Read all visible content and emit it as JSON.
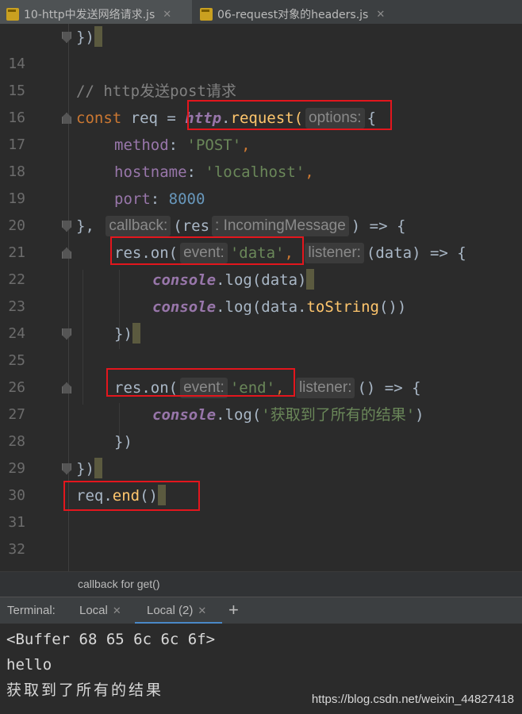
{
  "tabs": [
    {
      "label": "10-http中发送网络请求.js",
      "active": true
    },
    {
      "label": "06-request对象的headers.js",
      "active": false
    }
  ],
  "editor": {
    "line_numbers": [
      "14",
      "15",
      "16",
      "17",
      "18",
      "19",
      "20",
      "21",
      "22",
      "23",
      "24",
      "25",
      "26",
      "27",
      "28",
      "29",
      "30",
      "31",
      "32"
    ],
    "code": {
      "l14_close": "})",
      "l16_comment": "// http发送post请求",
      "l17_const": "const ",
      "l17_req": "req = ",
      "l17_http": "http",
      "l17_dot": ".",
      "l17_request": "request(",
      "l17_hint": "options:",
      "l17_brace": "{",
      "l18_key": "method",
      "l18_colon": ": ",
      "l18_val": "'POST'",
      "l18_comma": ",",
      "l19_key": "hostname",
      "l19_colon": ": ",
      "l19_val": "'localhost'",
      "l19_comma": ",",
      "l20_key": "port",
      "l20_colon": ": ",
      "l20_val": "8000",
      "l21_close": "},",
      "l21_hint": "callback:",
      "l21_paren": "(res",
      "l21_type": ": IncomingMessage",
      "l21_arrow": ") => {",
      "l22_res": "res.on(",
      "l22_hint": "event:",
      "l22_val": "'data'",
      "l22_comma": ",",
      "l22_hint2": "listener:",
      "l22_rest": "(data) => {",
      "l23_console": "console",
      "l23_rest": ".log(data)",
      "l24_console": "console",
      "l24_a": ".log(data.",
      "l24_fn": "toString",
      "l24_b": "())",
      "l25_close": "})",
      "l27_res": "res.on(",
      "l27_hint": "event:",
      "l27_val": "'end'",
      "l27_comma": ",",
      "l27_hint2": "listener:",
      "l27_rest": "() => {",
      "l28_console": "console",
      "l28_a": ".log(",
      "l28_val": "'获取到了所有的结果'",
      "l28_b": ")",
      "l29_close": "})",
      "l30_close": "})",
      "l31_a": "req.",
      "l31_fn": "end",
      "l31_b": "()"
    }
  },
  "hint_bar": {
    "text": "callback for get()"
  },
  "terminal": {
    "label": "Terminal:",
    "tabs": [
      {
        "label": "Local",
        "active": false
      },
      {
        "label": "Local (2)",
        "active": true
      }
    ],
    "new_tab": "+",
    "output": [
      "<Buffer 68 65 6c 6c 6f>",
      "hello",
      "获取到了所有的结果"
    ]
  },
  "watermark": "https://blog.csdn.net/weixin_44827418",
  "colors": {
    "highlight_box": "#e3161d",
    "keyword": "#cc7832",
    "string": "#6a8759",
    "number": "#6897bb"
  }
}
